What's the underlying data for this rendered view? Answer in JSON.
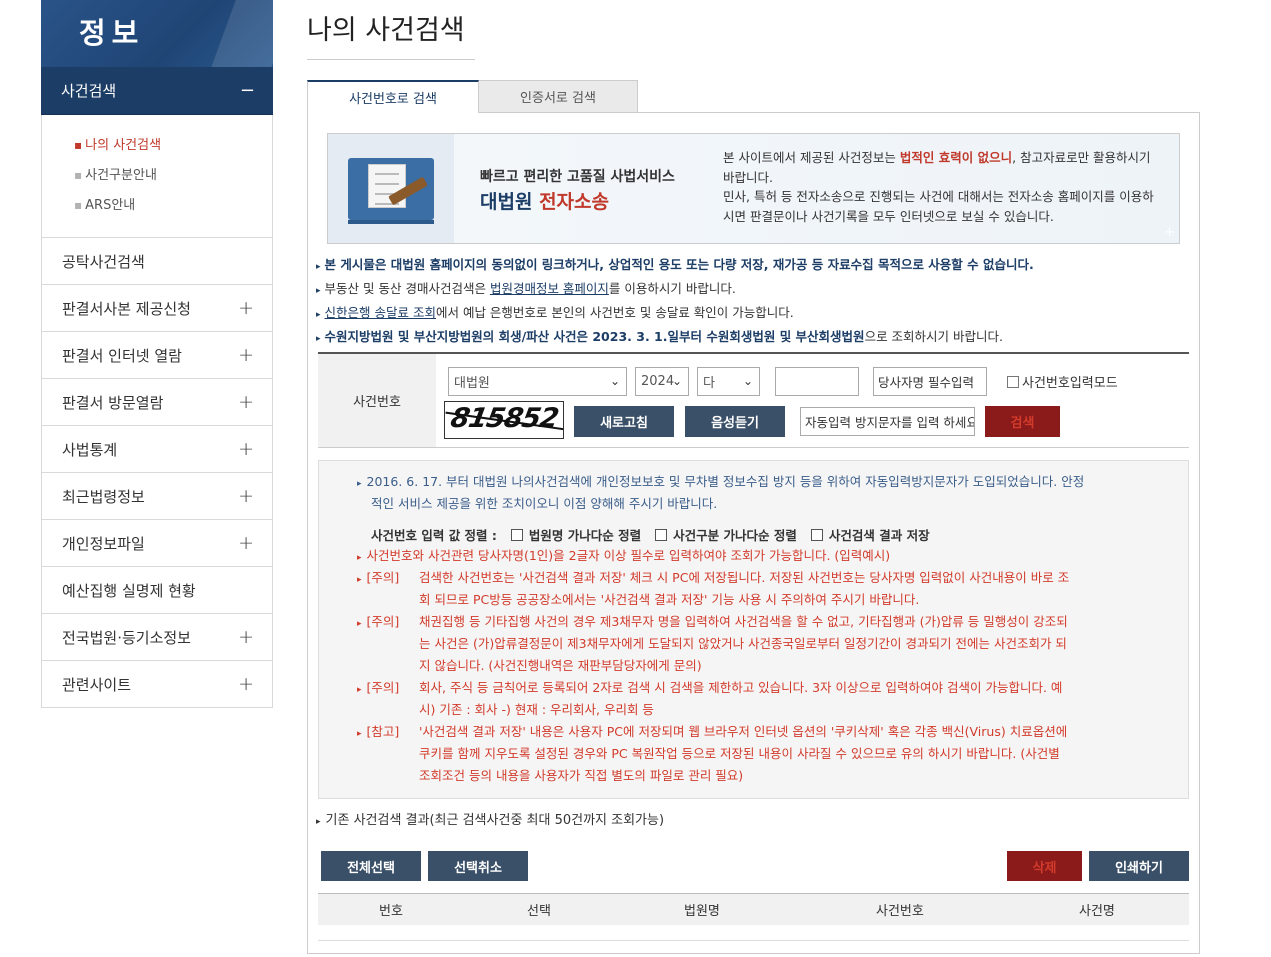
{
  "sidebar": {
    "header": "정보",
    "active": "사건검색",
    "active_toggle": "−",
    "sub_items": [
      "나의 사건검색",
      "사건구분안내",
      "ARS안내"
    ],
    "items": [
      {
        "label": "공탁사건검색",
        "toggle": ""
      },
      {
        "label": "판결서사본 제공신청",
        "toggle": "+"
      },
      {
        "label": "판결서 인터넷 열람",
        "toggle": "+"
      },
      {
        "label": "판결서 방문열람",
        "toggle": "+"
      },
      {
        "label": "사법통계",
        "toggle": "+"
      },
      {
        "label": "최근법령정보",
        "toggle": "+"
      },
      {
        "label": "개인정보파일",
        "toggle": "+"
      },
      {
        "label": "예산집행 실명제 현황",
        "toggle": ""
      },
      {
        "label": "전국법원·등기소정보",
        "toggle": "+"
      },
      {
        "label": "관련사이트",
        "toggle": "+"
      }
    ]
  },
  "page": {
    "title": "나의 사건검색",
    "tabs": [
      "사건번호로 검색",
      "인증서로 검색"
    ]
  },
  "banner": {
    "subtitle": "빠르고 편리한 고품질 사법서비스",
    "main_a": "대법원 ",
    "main_b": "전자소송",
    "text1": "본 사이트에서 제공된 사건정보는 ",
    "text_bold": "법적인 효력이 없으니",
    "text2": ", 참고자료로만 활용하시기 바랍니다.",
    "text3": "민사, 특허 등 전자소송으로 진행되는 사건에 대해서는 전자소송 홈페이지를 이용하시면 판결문이나 사건기록을 모두 인터넷으로 보실 수 있습니다.",
    "plus": "+"
  },
  "notices": {
    "n1": "본 게시물은 대법원 홈페이지의 동의없이 링크하거나, 상업적인 용도 또는 다량 저장, 재가공 등 자료수집 목적으로 사용할 수 없습니다.",
    "n2_a": "부동산 및 동산 경매사건검색은 ",
    "n2_link": "법원경매정보 홈페이지",
    "n2_b": "를 이용하시기 바랍니다.",
    "n3_link": "신한은행 송달료 조회",
    "n3_b": "에서 예납 은행번호로 본인의 사건번호 및 송달료 확인이 가능합니다.",
    "n4_a": "수원지방법원 및 부산지방법원의 회생/파산 사건은 2023. 3. 1.일부터 수원회생법원 및 부산회생법원",
    "n4_b": "으로 조회하시기 바랍니다."
  },
  "form": {
    "label": "사건번호",
    "court": "대법원",
    "year": "2024",
    "type": "다",
    "case_number": "",
    "party_placeholder": "당사자명 필수입력",
    "input_mode_label": "사건번호입력모드",
    "captcha_text": "815852",
    "refresh_label": "새로고침",
    "audio_label": "음성듣기",
    "captcha_placeholder": "자동입력 방지문자를 입력 하세요",
    "search_label": "검색"
  },
  "info": {
    "l1": "2016. 6. 17. 부터 대법원 나의사건검색에 개인정보보호 및 무차별 정보수집 방지 등을 위하여 자동입력방지문자가 도입되었습니다. 안정",
    "l2": "적인 서비스 제공을 위한 조치이오니 이점 양해해 주시기 바랍니다.",
    "sort_label": "사건번호 입력 값 정렬 :",
    "sort1": "법원명 가나다순 정렬",
    "sort2": "사건구분 가나다순 정렬",
    "sort3": "사건검색 결과 저장",
    "l3": "사건번호와 사건관련 당사자명(1인)을 2글자 이상 필수로 입력하여야 조회가 가능합니다. (입력예시)",
    "tag_warn": "[주의]",
    "tag_ref": "[참고]",
    "w1a": "검색한 사건번호는 '사건검색 결과 저장' 체크 시 PC에 저장됩니다. 저장된 사건번호는 당사자명 입력없이 사건내용이 바로 조",
    "w1b": "회 되므로 PC방등 공공장소에서는 '사건검색 결과 저장' 기능 사용 시 주의하여 주시기 바랍니다.",
    "w2a": "채권집행 등 기타집행 사건의 경우 제3채무자 명을 입력하여 사건검색을 할 수 없고, 기타집행과 (가)압류 등 밀행성이 강조되",
    "w2b": "는 사건은 (가)압류결정문이 제3채무자에게 도달되지 않았거나 사건종국일로부터 일정기간이 경과되기 전에는 사건조회가 되",
    "w2c": "지 않습니다. (사건진행내역은 재판부담당자에게 문의)",
    "w3a": "회사, 주식 등 금칙어로 등록되어 2자로 검색 시 검색을 제한하고 있습니다. 3자 이상으로 입력하여야 검색이 가능합니다. 예",
    "w3b": "시) 기존 : 회사 -) 현재 : 우리회사, 우리회 등",
    "r1a": "'사건검색 결과 저장' 내용은 사용자 PC에 저장되며 웹 브라우저 인터넷 옵션의 '쿠키삭제' 혹은 각종 백신(Virus) 치료옵션에",
    "r1b": "쿠키를 함께 지우도록 설정된 경우와 PC 복원작업 등으로 저장된 내용이 사라질 수 있으므로 유의 하시기 바랍니다. (사건별",
    "r1c": "조회조건 등의 내용을 사용자가 직접 별도의 파일로 관리 필요)"
  },
  "results": {
    "label": "기존 사건검색 결과(최근 검색사건중 최대 50건까지 조회가능)",
    "select_all": "전체선택",
    "deselect": "선택취소",
    "delete": "삭제",
    "print": "인쇄하기",
    "columns": [
      "번호",
      "선택",
      "법원명",
      "사건번호",
      "사건명"
    ]
  },
  "colors": {
    "navy": "#1c3d66",
    "button_navy": "#3a5068",
    "button_red": "#8b1a1a",
    "warning_red": "#d23b2b"
  }
}
